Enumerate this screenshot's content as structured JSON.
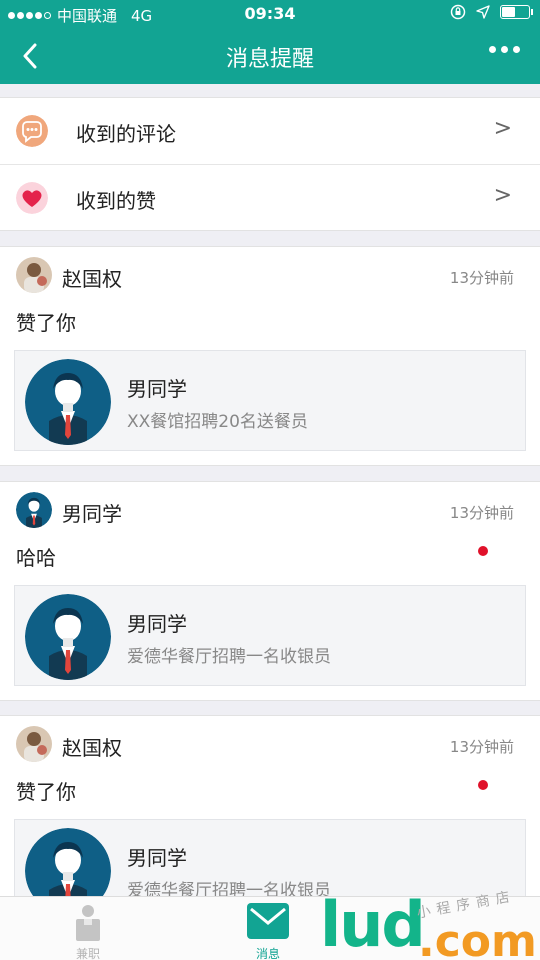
{
  "status_bar": {
    "carrier": "中国联通",
    "network": "4G",
    "time": "09:34",
    "battery_level": 0.5
  },
  "nav": {
    "title": "消息提醒",
    "back_icon": "chevron-left-icon",
    "more_icon": "more-dots-icon"
  },
  "menu": [
    {
      "label": "收到的评论",
      "icon": "comment-bubble-icon",
      "icon_color": "#f0a77c",
      "arrow": ">"
    },
    {
      "label": "收到的赞",
      "icon": "heart-icon",
      "icon_color": "#f36b8a",
      "arrow": ">"
    }
  ],
  "messages": [
    {
      "name": "赵国权",
      "time": "13分钟前",
      "content": "赞了你",
      "unread": false,
      "avatar": "photo-avatar",
      "ref": {
        "title": "男同学",
        "subtitle": "XX餐馆招聘20名送餐员"
      }
    },
    {
      "name": "男同学",
      "time": "13分钟前",
      "content": "哈哈",
      "unread": true,
      "avatar": "suit-avatar",
      "ref": {
        "title": "男同学",
        "subtitle": "爱德华餐厅招聘一名收银员"
      }
    },
    {
      "name": "赵国权",
      "time": "13分钟前",
      "content": "赞了你",
      "unread": true,
      "avatar": "photo-avatar",
      "ref": {
        "title": "男同学",
        "subtitle": "爱德华餐厅招聘一名收银员"
      }
    }
  ],
  "tabs": [
    {
      "label": "兼职",
      "icon": "briefcase-icon",
      "active": false
    },
    {
      "label": "消息",
      "icon": "message-envelope-icon",
      "active": true
    }
  ],
  "colors": {
    "primary": "#12a493",
    "unread": "#e0112a",
    "background": "#efeff4"
  },
  "watermark": {
    "big": "lud",
    "com": ".com",
    "small": "小程序商店"
  }
}
